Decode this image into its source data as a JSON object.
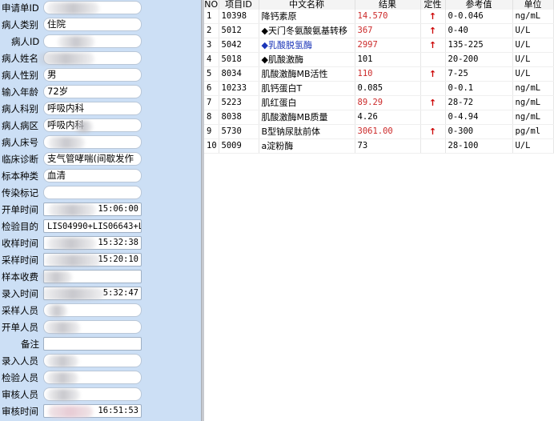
{
  "form": {
    "fields": [
      {
        "label": "申请单ID",
        "value": ""
      },
      {
        "label": "病人类别",
        "value": "住院"
      },
      {
        "label": "病人ID",
        "value": ""
      },
      {
        "label": "病人姓名",
        "value": ""
      },
      {
        "label": "病人性别",
        "value": "男"
      },
      {
        "label": "输入年龄",
        "value": "72岁"
      },
      {
        "label": "病人科别",
        "value": "呼吸内科"
      },
      {
        "label": "病人病区",
        "value": "呼吸内科"
      },
      {
        "label": "病人床号",
        "value": ""
      },
      {
        "label": "临床诊断",
        "value": "支气管哮喘(间歇发作"
      },
      {
        "label": "标本种类",
        "value": "血清"
      },
      {
        "label": "传染标记",
        "value": ""
      },
      {
        "label": "开单时间",
        "value": "15:06:00"
      },
      {
        "label": "检验目的",
        "value": "LIS04990+LIS06643+L"
      },
      {
        "label": "收样时间",
        "value": "15:32:38"
      },
      {
        "label": "采样时间",
        "value": "15:20:10"
      },
      {
        "label": "样本收费",
        "value": ""
      },
      {
        "label": "录入时间",
        "value": "5:32:47"
      },
      {
        "label": "采样人员",
        "value": ""
      },
      {
        "label": "开单人员",
        "value": ""
      },
      {
        "label": "备注",
        "value": ""
      },
      {
        "label": "录入人员",
        "value": ""
      },
      {
        "label": "检验人员",
        "value": ""
      },
      {
        "label": "审核人员",
        "value": ""
      },
      {
        "label": "审核时间",
        "value": "16:51:53"
      }
    ]
  },
  "results": {
    "headers": [
      "NO",
      "项目ID",
      "中文名称",
      "结果",
      "定性",
      "参考值",
      "单位"
    ],
    "rows": [
      {
        "no": "1",
        "id": "10398",
        "name": "降钙素原",
        "result": "14.570",
        "flag": "↑",
        "ref": "0-0.046",
        "unit": "ng/mL",
        "style": "red"
      },
      {
        "no": "2",
        "id": "5012",
        "name": "◆天门冬氨酸氨基转移",
        "result": "367",
        "flag": "↑",
        "ref": "0-40",
        "unit": "U/L",
        "style": "red"
      },
      {
        "no": "3",
        "id": "5042",
        "name": "◆乳酸脱氢酶",
        "result": "2997",
        "flag": "↑",
        "ref": "135-225",
        "unit": "U/L",
        "style": "red",
        "name_style": "blue"
      },
      {
        "no": "4",
        "id": "5018",
        "name": "◆肌酸激酶",
        "result": "101",
        "flag": "",
        "ref": "20-200",
        "unit": "U/L",
        "style": ""
      },
      {
        "no": "5",
        "id": "8034",
        "name": "肌酸激酶MB活性",
        "result": "110",
        "flag": "↑",
        "ref": "7-25",
        "unit": "U/L",
        "style": "red"
      },
      {
        "no": "6",
        "id": "10233",
        "name": "肌钙蛋白T",
        "result": "0.085",
        "flag": "",
        "ref": "0-0.1",
        "unit": "ng/mL",
        "style": ""
      },
      {
        "no": "7",
        "id": "5223",
        "name": "肌红蛋白",
        "result": "89.29",
        "flag": "↑",
        "ref": "28-72",
        "unit": "ng/mL",
        "style": "red"
      },
      {
        "no": "8",
        "id": "8038",
        "name": "肌酸激酶MB质量",
        "result": "4.26",
        "flag": "",
        "ref": "0-4.94",
        "unit": "ng/mL",
        "style": ""
      },
      {
        "no": "9",
        "id": "5730",
        "name": "B型钠尿肽前体",
        "result": "3061.00",
        "flag": "↑",
        "ref": "0-300",
        "unit": "pg/ml",
        "style": "red"
      },
      {
        "no": "10",
        "id": "5009",
        "name": "a淀粉酶",
        "result": "73",
        "flag": "",
        "ref": "28-100",
        "unit": "U/L",
        "style": ""
      }
    ]
  }
}
